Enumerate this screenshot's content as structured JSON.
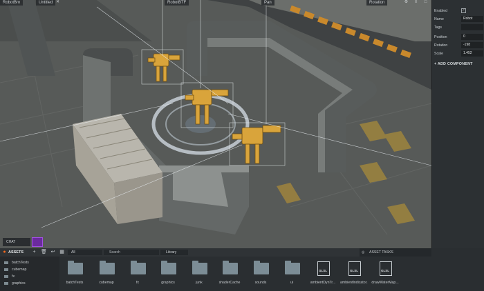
{
  "viewport": {
    "tabs": [
      "RobotBrn",
      "Untitled",
      "RobotBTF",
      "Pan",
      "Rotation"
    ]
  },
  "inspector": {
    "rows": [
      {
        "label": "Enabled",
        "value": ""
      },
      {
        "label": "Name",
        "value": "Robot"
      },
      {
        "label": "Tags",
        "value": ""
      },
      {
        "label": "Position",
        "value": "0"
      },
      {
        "label": "Rotation",
        "value": "-198"
      },
      {
        "label": "Scale",
        "value": "1.452"
      }
    ],
    "enabled_mark": "✓",
    "add_component": "ADD COMPONENT"
  },
  "chat": {
    "label": "CHAT"
  },
  "asset_tasks": {
    "label": "ASSET TASKS"
  },
  "assets": {
    "title": "ASSETS",
    "filter": "All",
    "search_placeholder": "Search",
    "library": "Library",
    "tree": [
      "batchTests",
      "cubemap",
      "fx",
      "graphics"
    ],
    "items": [
      {
        "label": "batchTests",
        "type": "folder"
      },
      {
        "label": "cubemap",
        "type": "folder"
      },
      {
        "label": "fx",
        "type": "folder"
      },
      {
        "label": "graphics",
        "type": "folder"
      },
      {
        "label": "junk",
        "type": "folder"
      },
      {
        "label": "shaderCache",
        "type": "folder"
      },
      {
        "label": "sounds",
        "type": "folder"
      },
      {
        "label": "ui",
        "type": "folder"
      },
      {
        "label": "ambientDynTr...",
        "type": "glsl"
      },
      {
        "label": "ambientIndicator...",
        "type": "glsl"
      },
      {
        "label": "drawWaterMap...",
        "type": "glsl"
      }
    ],
    "glsl_tag": "GLSL"
  },
  "colors": {
    "accent": "#ff6a1a",
    "panel": "#2a2e31",
    "floor": "#5c5f5d",
    "robot": "#d9a43b"
  }
}
